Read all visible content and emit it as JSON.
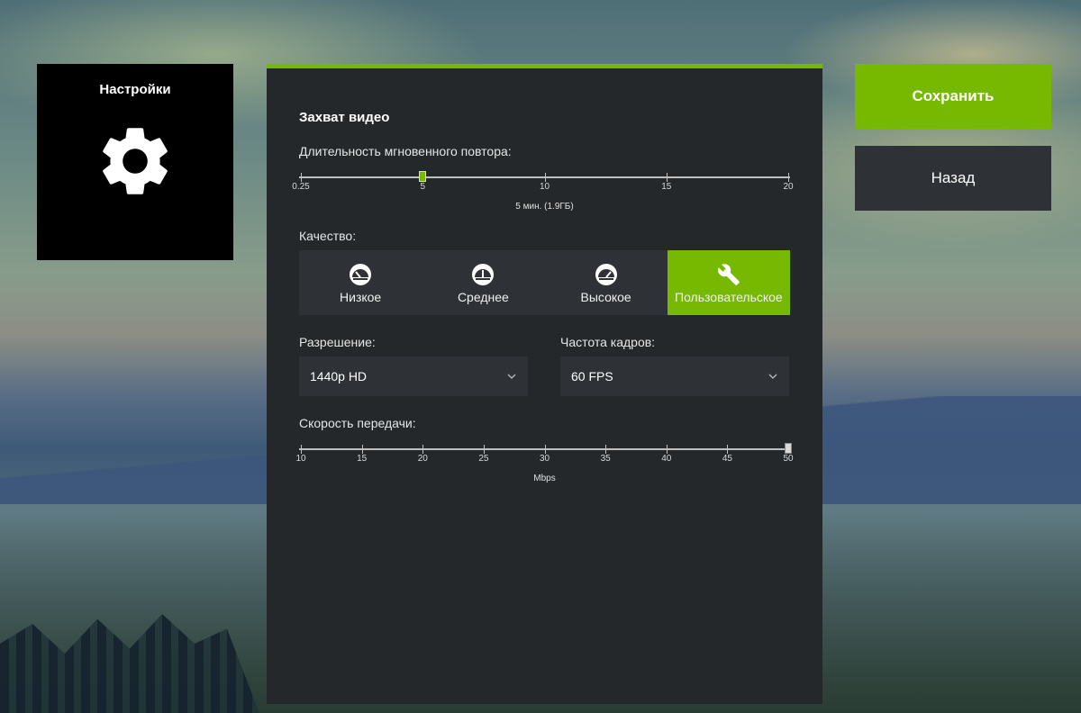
{
  "tile": {
    "title": "Настройки",
    "icon": "gear-icon"
  },
  "panel": {
    "section_title": "Захват видео",
    "replay": {
      "label": "Длительность мгновенного повтора:",
      "ticks": [
        "0.25",
        "5",
        "10",
        "15",
        "20"
      ],
      "value": 5,
      "caption": "5 мин. (1.9ГБ)"
    },
    "quality": {
      "label": "Качество:",
      "options": [
        {
          "label": "Низкое",
          "icon": "gauge-low-icon",
          "active": false
        },
        {
          "label": "Среднее",
          "icon": "gauge-medium-icon",
          "active": false
        },
        {
          "label": "Высокое",
          "icon": "gauge-high-icon",
          "active": false
        },
        {
          "label": "Пользовательское",
          "icon": "wrench-icon",
          "active": true
        }
      ]
    },
    "resolution": {
      "label": "Разрешение:",
      "value": "1440p HD"
    },
    "framerate": {
      "label": "Частота кадров:",
      "value": "60 FPS"
    },
    "bitrate": {
      "label": "Скорость передачи:",
      "ticks": [
        "10",
        "15",
        "20",
        "25",
        "30",
        "35",
        "40",
        "45",
        "50"
      ],
      "value": 50,
      "caption": "Mbps"
    }
  },
  "buttons": {
    "save": "Сохранить",
    "back": "Назад"
  },
  "colors": {
    "accent": "#76b900",
    "panel": "#24282b",
    "control": "#2e3236"
  }
}
